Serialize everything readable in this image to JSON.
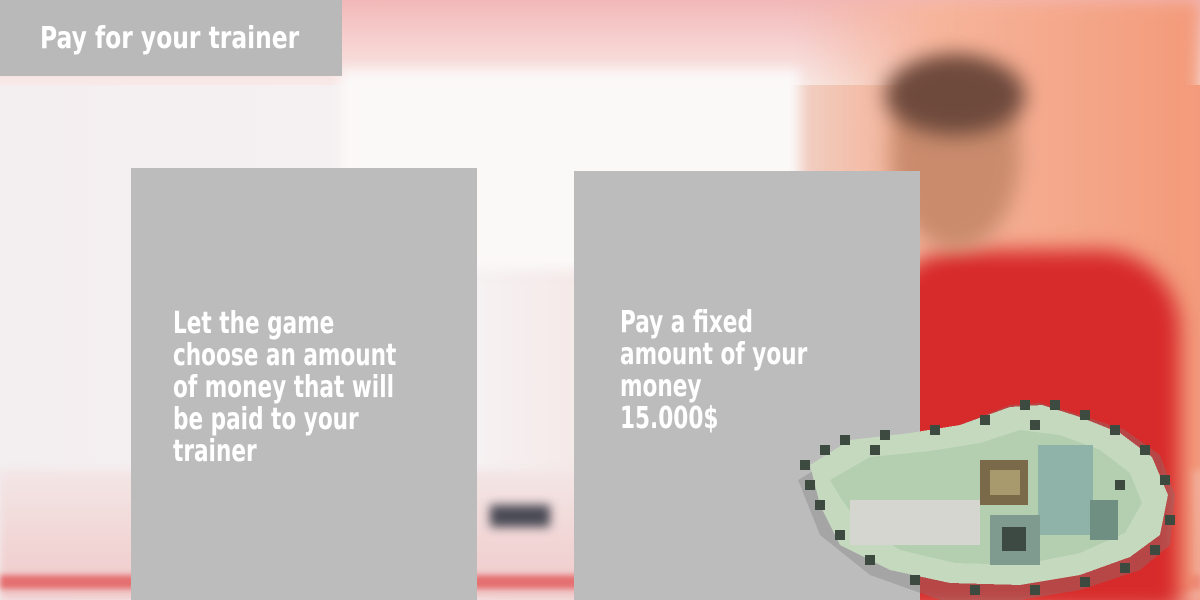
{
  "screen": {
    "title": "Pay for your trainer"
  },
  "options": {
    "random": {
      "lines": [
        "Let the game",
        "choose an amount",
        "of money that will",
        "be paid to your",
        "trainer"
      ]
    },
    "fixed": {
      "lines": [
        "Pay a fixed",
        "amount of your",
        "money",
        "15.000$"
      ]
    }
  },
  "icons": {
    "money": "money-bills-icon"
  },
  "colors": {
    "panel": "#bcbcbc",
    "text": "#ffffff"
  }
}
